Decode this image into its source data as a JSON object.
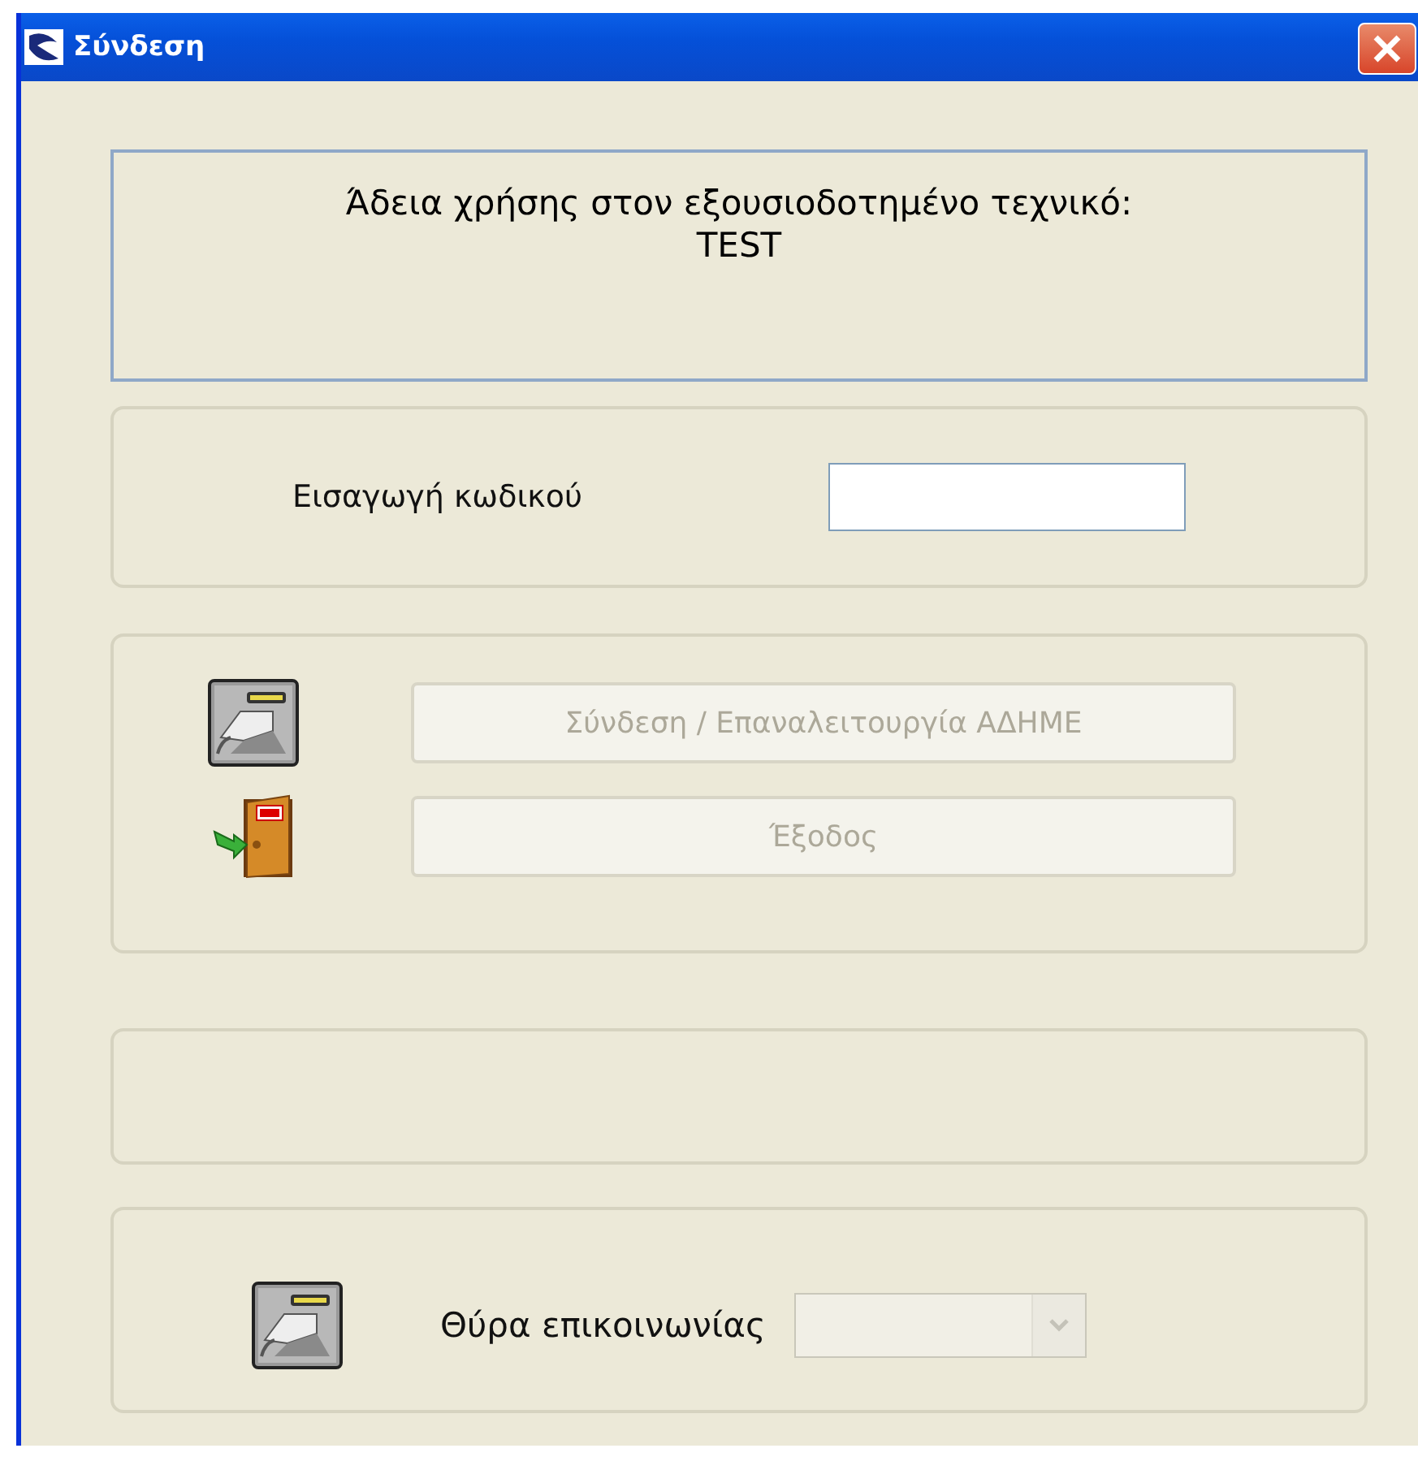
{
  "window": {
    "title": "Σύνδεση"
  },
  "license": {
    "text": "Άδεια χρήσης στον εξουσιοδοτημένο τεχνικό:",
    "technician": "TEST"
  },
  "password": {
    "label": "Εισαγωγή κωδικού"
  },
  "actions": [
    {
      "kind": "connect",
      "label": "Σύνδεση / Επαναλειτουργία ΑΔΗΜΕ",
      "disabled": true
    },
    {
      "kind": "exit",
      "label": "Έξοδος",
      "disabled": true
    }
  ],
  "port": {
    "label": "Θύρα επικοινωνίας",
    "disabled": true
  }
}
